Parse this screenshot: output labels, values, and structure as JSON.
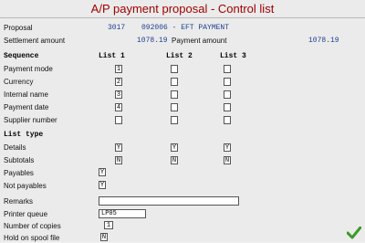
{
  "title": "A/P payment proposal - Control list",
  "proposal": {
    "label": "Proposal",
    "number": "3017",
    "description": "092006 - EFT PAYMENT"
  },
  "settlement": {
    "label": "Settlement amount",
    "value": "1078.19"
  },
  "payment": {
    "label": "Payment amount",
    "value": "1078.19"
  },
  "sequence": {
    "header": "Sequence",
    "col1": "List 1",
    "col2": "List 2",
    "col3": "List 3",
    "rows": [
      {
        "label": "Payment mode",
        "list1": "1",
        "list2": "",
        "list3": ""
      },
      {
        "label": "Currency",
        "list1": "2",
        "list2": "",
        "list3": ""
      },
      {
        "label": "Internal name",
        "list1": "3",
        "list2": "",
        "list3": ""
      },
      {
        "label": "Payment date",
        "list1": "4",
        "list2": "",
        "list3": ""
      },
      {
        "label": "Supplier number",
        "list1": "",
        "list2": "",
        "list3": ""
      }
    ]
  },
  "list_type": {
    "header": "List type",
    "rows": [
      {
        "label": "Details",
        "list1": "Y",
        "list2": "Y",
        "list3": "Y"
      },
      {
        "label": "Subtotals",
        "list1": "N",
        "list2": "N",
        "list3": "N"
      }
    ]
  },
  "payables": {
    "label": "Payables",
    "value": "Y"
  },
  "not_payables": {
    "label": "Not payables",
    "value": "Y"
  },
  "remarks": {
    "label": "Remarks",
    "value": ""
  },
  "printer_queue": {
    "label": "Printer queue",
    "value": "LP05"
  },
  "copies": {
    "label": "Number of copies",
    "value": "1"
  },
  "hold_spool": {
    "label": "Hold on spool file",
    "value": "N"
  },
  "ok_icon": "checkmark-icon",
  "colors": {
    "title": "#a00000",
    "value": "#1f3f8f",
    "ok": "#3a9a2a"
  }
}
